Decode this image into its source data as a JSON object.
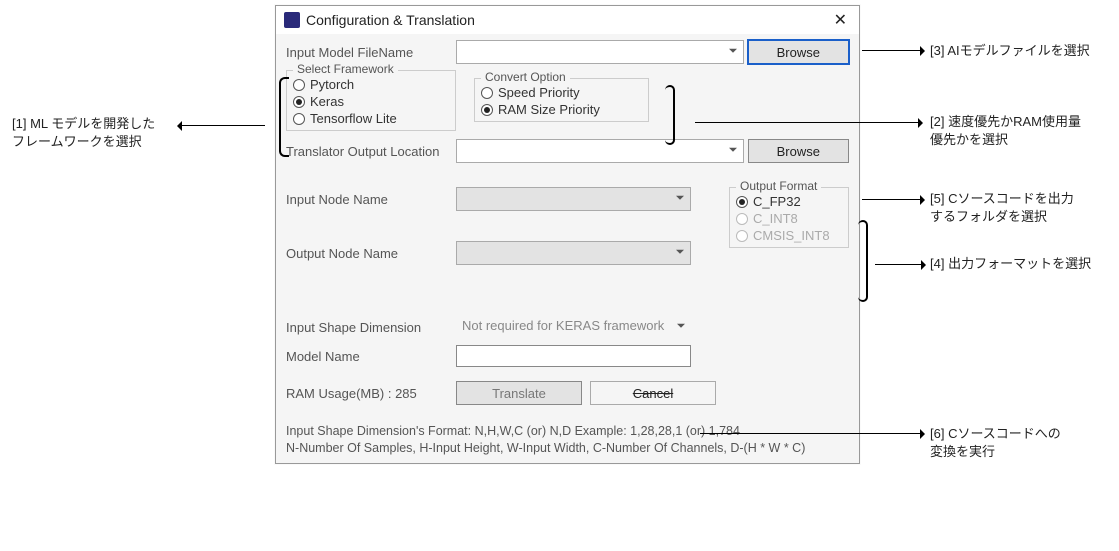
{
  "window": {
    "title": "Configuration & Translation"
  },
  "labels": {
    "input_model": "Input Model FileName",
    "translator_output": "Translator Output Location",
    "input_node": "Input Node Name",
    "output_node": "Output Node Name",
    "input_shape_dim": "Input Shape Dimension",
    "model_name": "Model Name",
    "ram_usage": "RAM Usage(MB) : 285"
  },
  "buttons": {
    "browse": "Browse",
    "translate": "Translate",
    "cancel": "Cancel"
  },
  "groups": {
    "framework": {
      "title": "Select Framework",
      "options": [
        "Pytorch",
        "Keras",
        "Tensorflow Lite"
      ],
      "selected": "Keras"
    },
    "convert": {
      "title": "Convert Option",
      "options": [
        "Speed Priority",
        "RAM Size Priority"
      ],
      "selected": "RAM Size Priority"
    },
    "output_format": {
      "title": "Output Format",
      "options": [
        "C_FP32",
        "C_INT8",
        "CMSIS_INT8"
      ],
      "selected": "C_FP32",
      "disabled": [
        "C_INT8",
        "CMSIS_INT8"
      ]
    }
  },
  "placeholders": {
    "input_shape": "Not required for KERAS framework"
  },
  "footer": {
    "line1": "Input Shape Dimension's Format: N,H,W,C (or) N,D    Example: 1,28,28,1 (or) 1,784",
    "line2": "N-Number Of Samples, H-Input Height, W-Input Width, C-Number Of Channels, D-(H * W * C)"
  },
  "annotations": {
    "a1": "[1] ML モデルを開発した\nフレームワークを選択",
    "a2": "[2] 速度優先かRAM使用量\n優先かを選択",
    "a3": "[3] AIモデルファイルを選択",
    "a4": "[4] 出力フォーマットを選択",
    "a5": "[5] Cソースコードを出力\nするフォルダを選択",
    "a6": "[6] Cソースコードへの\n変換を実行"
  }
}
